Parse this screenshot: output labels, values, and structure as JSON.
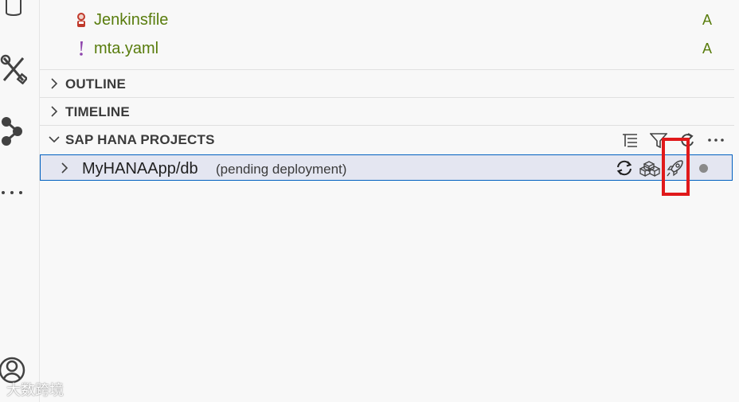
{
  "files": [
    {
      "name": "Jenkinsfile",
      "status": "A",
      "icon": "jenkins-icon"
    },
    {
      "name": "mta.yaml",
      "status": "A",
      "icon": "yaml-exclamation-icon"
    }
  ],
  "sections": {
    "outline": "OUTLINE",
    "timeline": "TIMELINE",
    "hana": "SAP HANA PROJECTS"
  },
  "project": {
    "name": "MyHANAApp/db",
    "description": "(pending deployment)"
  },
  "watermark": "大数跨境",
  "colors": {
    "file_green": "#587c0c",
    "selection_bg": "#e4e6f1",
    "selection_border": "#0060c0",
    "highlight_red": "#e0191b"
  }
}
